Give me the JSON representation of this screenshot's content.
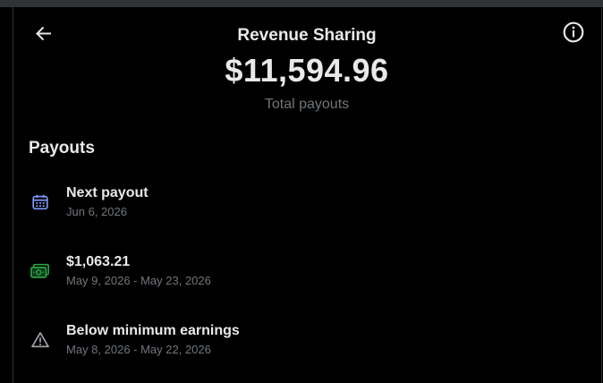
{
  "header": {
    "title": "Revenue Sharing",
    "back_icon": "arrow-left-icon",
    "info_icon": "info-circle-icon"
  },
  "summary": {
    "total_amount": "$11,594.96",
    "total_caption": "Total payouts"
  },
  "payouts": {
    "heading": "Payouts",
    "items": [
      {
        "icon": "calendar-icon",
        "icon_color": "#7e9cff",
        "title": "Next payout",
        "subtitle": "Jun 6, 2026"
      },
      {
        "icon": "money-bill-icon",
        "icon_color": "#2ea043",
        "title": "$1,063.21",
        "subtitle": "May 9, 2026 - May 23, 2026"
      },
      {
        "icon": "warning-triangle-icon",
        "icon_color": "#a3a7ab",
        "title": "Below minimum earnings",
        "subtitle": "May 8, 2026 - May 22, 2026"
      }
    ]
  },
  "colors": {
    "background": "#000000",
    "text_primary": "#e7e9ea",
    "text_secondary": "#71767b",
    "divider": "#2f3336"
  }
}
